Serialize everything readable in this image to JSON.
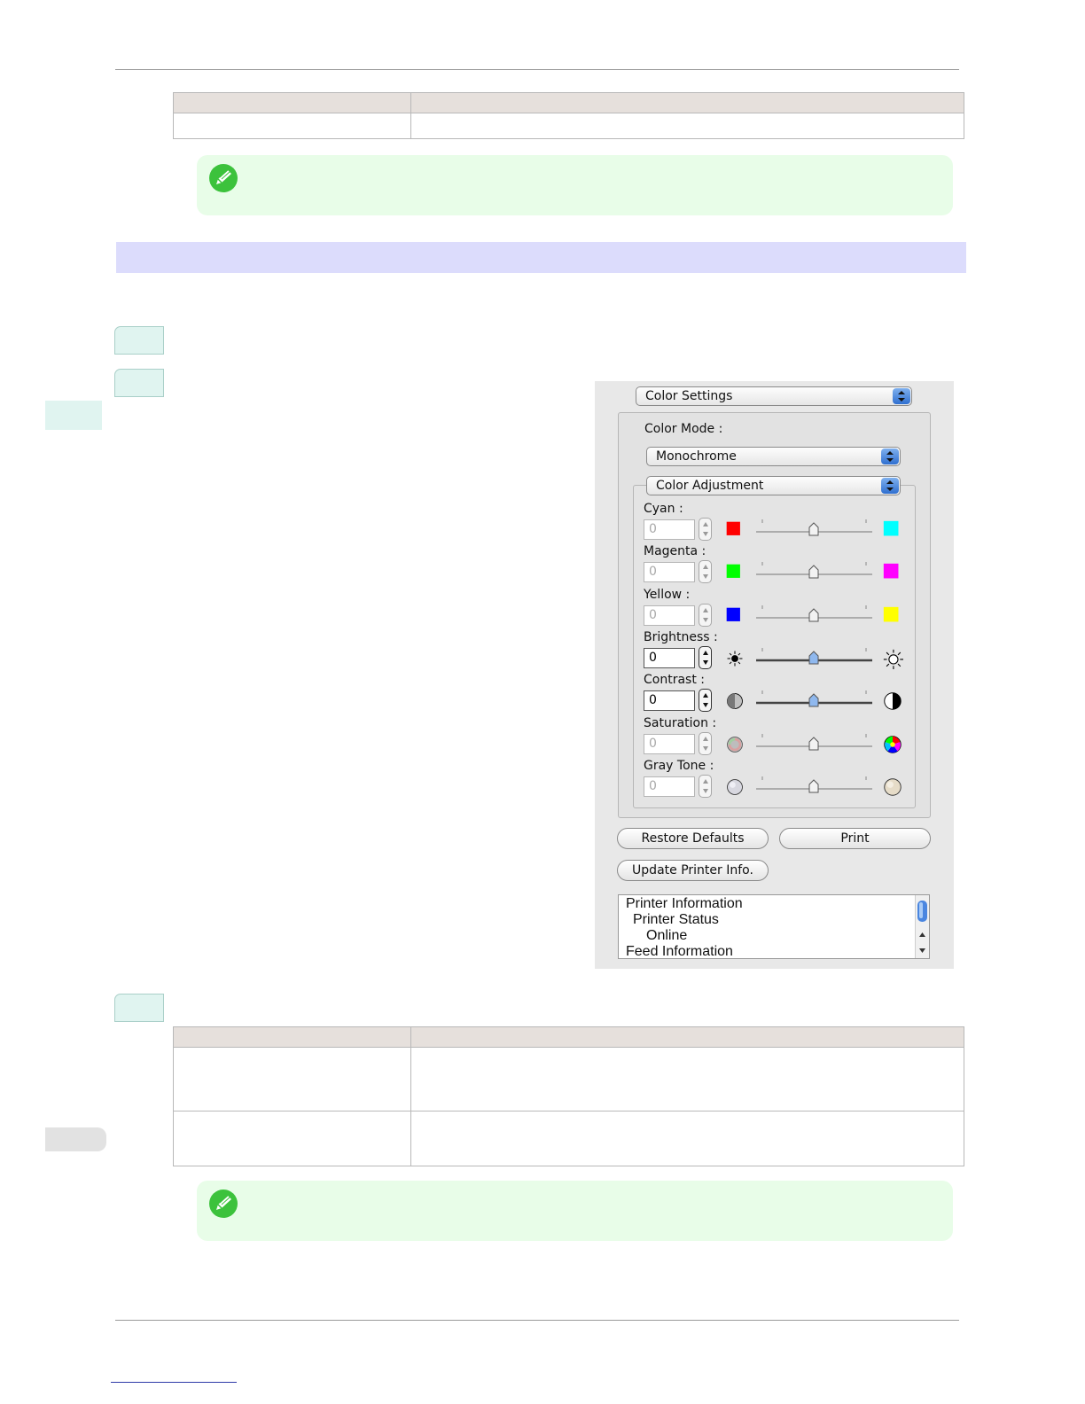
{
  "dialog": {
    "panel_popup": "Color Settings",
    "color_mode_label": "Color Mode :",
    "color_mode_value": "Monochrome",
    "adjust_popup": "Color Adjustment",
    "rows": [
      {
        "label": "Cyan :",
        "value": "0",
        "enabled": false,
        "left_icon": "red-swatch",
        "right_icon": "cyan-swatch"
      },
      {
        "label": "Magenta :",
        "value": "0",
        "enabled": false,
        "left_icon": "green-swatch",
        "right_icon": "magenta-swatch"
      },
      {
        "label": "Yellow :",
        "value": "0",
        "enabled": false,
        "left_icon": "blue-swatch",
        "right_icon": "yellow-swatch"
      },
      {
        "label": "Brightness :",
        "value": "0",
        "enabled": true,
        "left_icon": "brightness-low-icon",
        "right_icon": "brightness-high-icon"
      },
      {
        "label": "Contrast :",
        "value": "0",
        "enabled": true,
        "left_icon": "contrast-low-icon",
        "right_icon": "contrast-high-icon"
      },
      {
        "label": "Saturation :",
        "value": "0",
        "enabled": false,
        "left_icon": "saturation-low-icon",
        "right_icon": "saturation-high-icon"
      },
      {
        "label": "Gray Tone :",
        "value": "0",
        "enabled": false,
        "left_icon": "gray-tone-cool-icon",
        "right_icon": "gray-tone-warm-icon"
      }
    ],
    "buttons": {
      "restore": "Restore Defaults",
      "print": "Print",
      "update": "Update Printer Info."
    },
    "printer_info": [
      "Printer Information",
      "Printer Status",
      "Online",
      "Feed Information"
    ]
  },
  "colors": {
    "section_bar": "#dcdcfc",
    "note_bg": "#e8fde8",
    "table_header": "#e6e0dc",
    "step_tab": "#e0f4f0"
  }
}
